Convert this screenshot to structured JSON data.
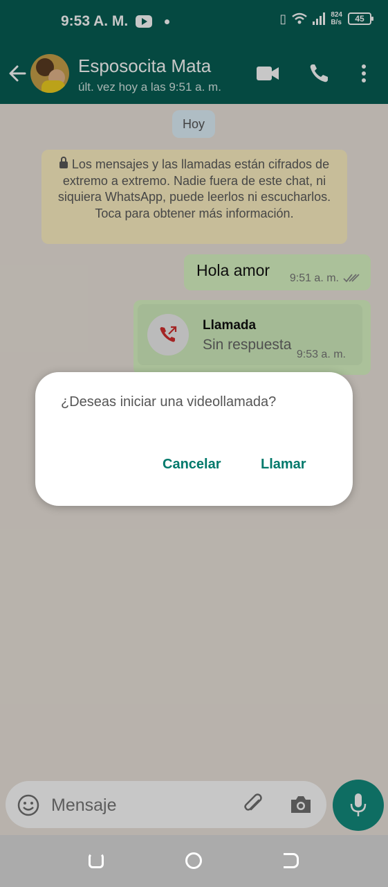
{
  "status_bar": {
    "time": "9:53 A. M.",
    "network_speed_value": "824",
    "network_speed_unit": "B/s",
    "battery": "45"
  },
  "header": {
    "contact_name": "Esposocita Mata",
    "last_seen": "últ. vez hoy a las 9:51 a. m.",
    "back_icon": "arrow-left-icon",
    "video_icon": "video-camera-icon",
    "call_icon": "phone-icon",
    "menu_icon": "more-vertical-icon"
  },
  "chat": {
    "date_label": "Hoy",
    "encryption_notice": "Los mensajes y las llamadas están cifrados de extremo a extremo. Nadie fuera de este chat, ni siquiera WhatsApp, puede leerlos ni escucharlos. Toca para obtener más información.",
    "messages": [
      {
        "text": "Hola amor",
        "time": "9:51 a. m.",
        "status": "read"
      },
      {
        "type": "call",
        "title": "Llamada",
        "subtitle": "Sin respuesta",
        "time": "9:53 a. m."
      }
    ]
  },
  "dialog": {
    "message": "¿Deseas iniciar una videollamada?",
    "cancel_label": "Cancelar",
    "confirm_label": "Llamar"
  },
  "input_bar": {
    "placeholder": "Mensaje"
  },
  "colors": {
    "header": "#075e54",
    "outgoing_bubble": "#dcf8c6",
    "accent": "#00796b",
    "mic_button": "#128c7e",
    "missed_call": "#d32f2f"
  }
}
